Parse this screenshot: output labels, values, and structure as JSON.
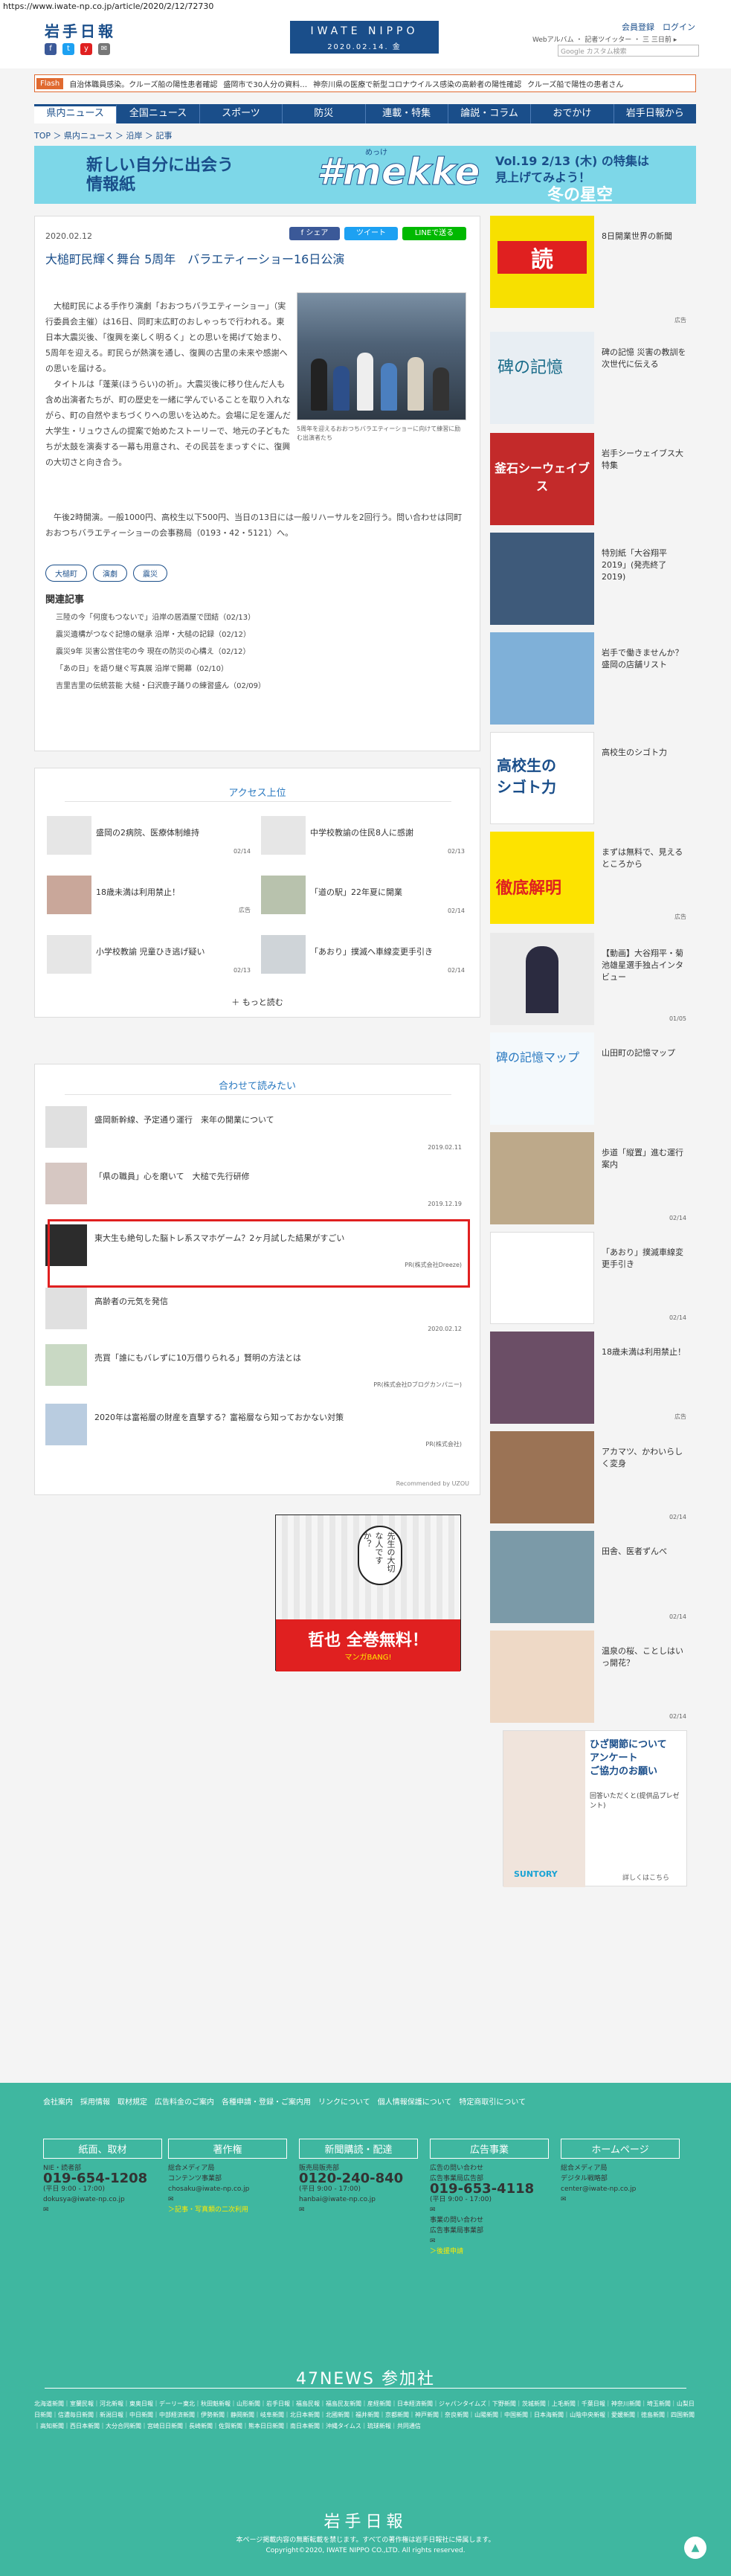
{
  "url": "https://www.iwate-np.co.jp/article/2020/2/12/72730",
  "header": {
    "logo": "岩手日報",
    "brand": "IWATE NIPPO",
    "brand_date": "2020.02.14. 金",
    "user_links": "会員登録　ログイン",
    "sub_links": "Webアルバム ・ 記者ツイッター ・ 三 三日前 ▸",
    "search_placeholder": "Google カスタム検索"
  },
  "sns": [
    "f",
    "t",
    "y",
    "✉"
  ],
  "flash": {
    "tag": "Flash",
    "items": [
      "自治体職員感染。クルーズ船の陽性患者確認",
      "盛岡市で30人分の資料…",
      "神奈川県の医療で新型コロナウイルス感染の高齢者の陽性確認",
      "クルーズ船で陽性の患者さん"
    ]
  },
  "nav": [
    "県内ニュース",
    "全国ニュース",
    "スポーツ",
    "防災",
    "連載・特集",
    "論説・コラム",
    "おでかけ",
    "岩手日報から"
  ],
  "breadcrumb": "TOP ＞ 県内ニュース ＞ 沿岸 ＞ 記事",
  "banner": {
    "line1": "新しい自分に出会う",
    "line2": "情報紙",
    "brand": "#mekke",
    "reading": "めっけ",
    "vol": "Vol.19 2/13 (木) の特集は",
    "find": "見上げてみよう！",
    "star": "冬の星空"
  },
  "article": {
    "date": "2020.02.12",
    "share_fb": "f シェア",
    "share_tw": "ツイート",
    "share_line": "LINEで送る",
    "title": "大槌町民輝く舞台 5周年　バラエティーショー16日公演",
    "paras": [
      "　大槌町民による手作り演劇「おおつちバラエティーショー」（実行委員会主催）は16日、同町末広町のおしゃっちで行われる。東日本大震災後、「復興を楽しく明るく」との思いを掲げて始まり、5周年を迎える。町民らが熱演を通し、復興の古里の未来や感謝への思いを届ける。",
      "　タイトルは「蓬莱(ほうらい)の祈」。大震災後に移り住んだ人も含め出演者たちが、町の歴史を一緒に学んでいることを取り入れながら、町の自然やまちづくりへの思いを込めた。会場に足を運んだ大学生・リュウさんの提案で始めたストーリーで、地元の子どもたちが太鼓を演奏する一幕も用意され、その民芸をまっすぐに、復興の大切さと向き合う。",
      "　午後2時開演。一般1000円、高校生以下500円、当日の13日には一般リハーサルを2回行う。問い合わせは同町おおつちバラエティーショーの会事務局（0193・42・5121）へ。"
    ],
    "caption": "5周年を迎えるおおつちバラエティーショーに向けて練習に励む出演者たち",
    "tags": [
      "大槌町",
      "演劇",
      "震災"
    ],
    "related_head": "関連記事",
    "related": [
      "三陸の今「何度もつないで」沿岸の居酒屋で団結（02/13）",
      "震災遺構がつなぐ記憶の継承 沿岸・大槌の記録（02/12）",
      "震災9年 災害公営住宅の今 現在の防災の心構え（02/12）",
      "「あの日」を語り継ぐ写真展 沿岸で開幕（02/10）",
      "吉里吉里の伝統芸能 大槌・臼沢鹿子踊りの練習盛ん（02/09）"
    ]
  },
  "ranking": {
    "title": "アクセス上位",
    "more": "もっと読む",
    "items": [
      {
        "text": "盛岡の2病院、医療体制維持",
        "date": "02/14"
      },
      {
        "text": "中学校教諭の住民8人に感謝",
        "date": "02/13"
      },
      {
        "text": "18歳未満は利用禁止！",
        "date": "広告"
      },
      {
        "text": "「道の駅」22年夏に開業",
        "date": "02/14"
      },
      {
        "text": "小学校教諭 児童ひき逃げ疑い",
        "date": "02/13"
      },
      {
        "text": "「あおり」撲滅へ車線変更手引き",
        "date": "02/14"
      }
    ]
  },
  "reco": {
    "title": "合わせて読みたい",
    "items": [
      {
        "text": "盛岡新幹線、予定通り運行　来年の開業について",
        "date": "2019.02.11"
      },
      {
        "text": "「県の職員」心を磨いて　大槌で先行研修",
        "date": "2019.12.19"
      },
      {
        "text": "東大生も絶句した脳トレ系スマホゲーム？2ヶ月試した結果がすごい",
        "date": "PR(株式会社Dreeze)"
      },
      {
        "text": "高齢者の元気を発信",
        "date": "2020.02.12"
      },
      {
        "text": "売買「誰にもバレずに10万借りられる」賢明の方法とは",
        "date": "PR(株式会社Dブログカンパニー)"
      },
      {
        "text": "2020年は富裕層の財産を直撃する？富裕層なら知っておかない対策",
        "date": "PR(株式会社)"
      }
    ],
    "powered": "Recommended by UZOU"
  },
  "manga": {
    "bubble": "先生の大切な人ですか？",
    "title": "哲也 全巻無料！",
    "sub": "マンガBANG!"
  },
  "sidebar": [
    {
      "text": "8日開業世界の新聞",
      "date": "広告"
    },
    {
      "text": "碑の記憶 災害の教訓を次世代に伝える",
      "date": ""
    },
    {
      "text": "岩手シーウェイブス大特集",
      "date": ""
    },
    {
      "text": "特別紙「大谷翔平2019」(発売終了2019)",
      "date": ""
    },
    {
      "text": "岩手で働きませんか？盛岡の店舗リスト",
      "date": ""
    },
    {
      "text": "高校生のシゴト力",
      "date": ""
    },
    {
      "text": "まずは無料で、見えるところから",
      "date": "広告"
    },
    {
      "text": "【動画】大谷翔平・菊池雄星選手独占インタビュー",
      "date": "01/05"
    },
    {
      "text": "山田町の記憶マップ",
      "date": ""
    },
    {
      "text": "歩道「縦置」進む運行案内",
      "date": "02/14"
    },
    {
      "text": "「あおり」撲滅車線変更手引き",
      "date": "02/14"
    },
    {
      "text": "18歳未満は利用禁止！",
      "date": "広告"
    },
    {
      "text": "アカマツ、かわいらしく変身",
      "date": "02/14"
    },
    {
      "text": "田舎、医者ずんべ",
      "date": "02/14"
    },
    {
      "text": "温泉の桜、ことしはいっ開花？",
      "date": "02/14"
    }
  ],
  "ad_knee": {
    "line1": "ひざ関節について",
    "line2": "アンケート",
    "line3": "ご協力のお願い",
    "note": "回答いただくと(提供品プレゼント)",
    "brand": "SUNTORY",
    "detail": "詳しくはこちら"
  },
  "footer": {
    "links": "会社案内　採用情報　取材規定　広告料金のご案内　各種申請・登録・ご案内用　リンクについて　個人情報保護について　特定商取引について",
    "cols": [
      {
        "head": "紙面、取材",
        "l1": "NIE・読者部",
        "phone": "019-654-1208",
        "l2": "(平日 9:00 - 17:00)",
        "mail": "dokusya@iwate-np.co.jp"
      },
      {
        "head": "著作権",
        "l1": "総合メディア局",
        "l2": "コンテンツ事業部",
        "mail": "chosaku@iwate-np.co.jp",
        "l3": "＞記事・写真類の二次利用"
      },
      {
        "head": "新聞購読・配達",
        "l1": "販売局販売部",
        "phone": "0120-240-840",
        "l2": "(平日 9:00 - 17:00)",
        "mail": "hanbai@iwate-np.co.jp"
      },
      {
        "head": "広告事業",
        "l1": "広告の問い合わせ",
        "l2": "広告事業局広告部",
        "phone": "019-653-4118",
        "l3": "(平日 9:00 - 17:00)",
        "l4": "事業の問い合わせ",
        "l5": "広告事業局事業部",
        "l6": "＞後援申請"
      },
      {
        "head": "ホームページ",
        "l1": "総合メディア局",
        "l2": "デジタル戦略部",
        "mail": "center@iwate-np.co.jp"
      }
    ],
    "n47": "47NEWS 参加社",
    "papers": "北海道新聞｜室蘭民報｜河北新報｜東奥日報｜デーリー東北｜秋田魁新報｜山形新聞｜岩手日報｜福島民報｜福島民友新聞｜産経新聞｜日本経済新聞｜ジャパンタイムズ｜下野新聞｜茨城新聞｜上毛新聞｜千葉日報｜神奈川新聞｜埼玉新聞｜山梨日日新聞｜信濃毎日新聞｜新潟日報｜中日新聞｜中部経済新聞｜伊勢新聞｜静岡新聞｜岐阜新聞｜北日本新聞｜北國新聞｜福井新聞｜京都新聞｜神戸新聞｜奈良新聞｜山陽新聞｜中国新聞｜日本海新聞｜山陰中央新報｜愛媛新聞｜徳島新聞｜四国新聞｜高知新聞｜西日本新聞｜大分合同新聞｜宮崎日日新聞｜長崎新聞｜佐賀新聞｜熊本日日新聞｜南日本新聞｜沖縄タイムス｜琉球新報｜共同通信",
    "logo": "岩手日報",
    "copy1": "本ページ掲載内容の無断転載を禁じます。すべての著作権は岩手日報社に帰属します。",
    "copy2": "Copyright©2020, IWATE NIPPO CO.,LTD. All rights reserved."
  }
}
